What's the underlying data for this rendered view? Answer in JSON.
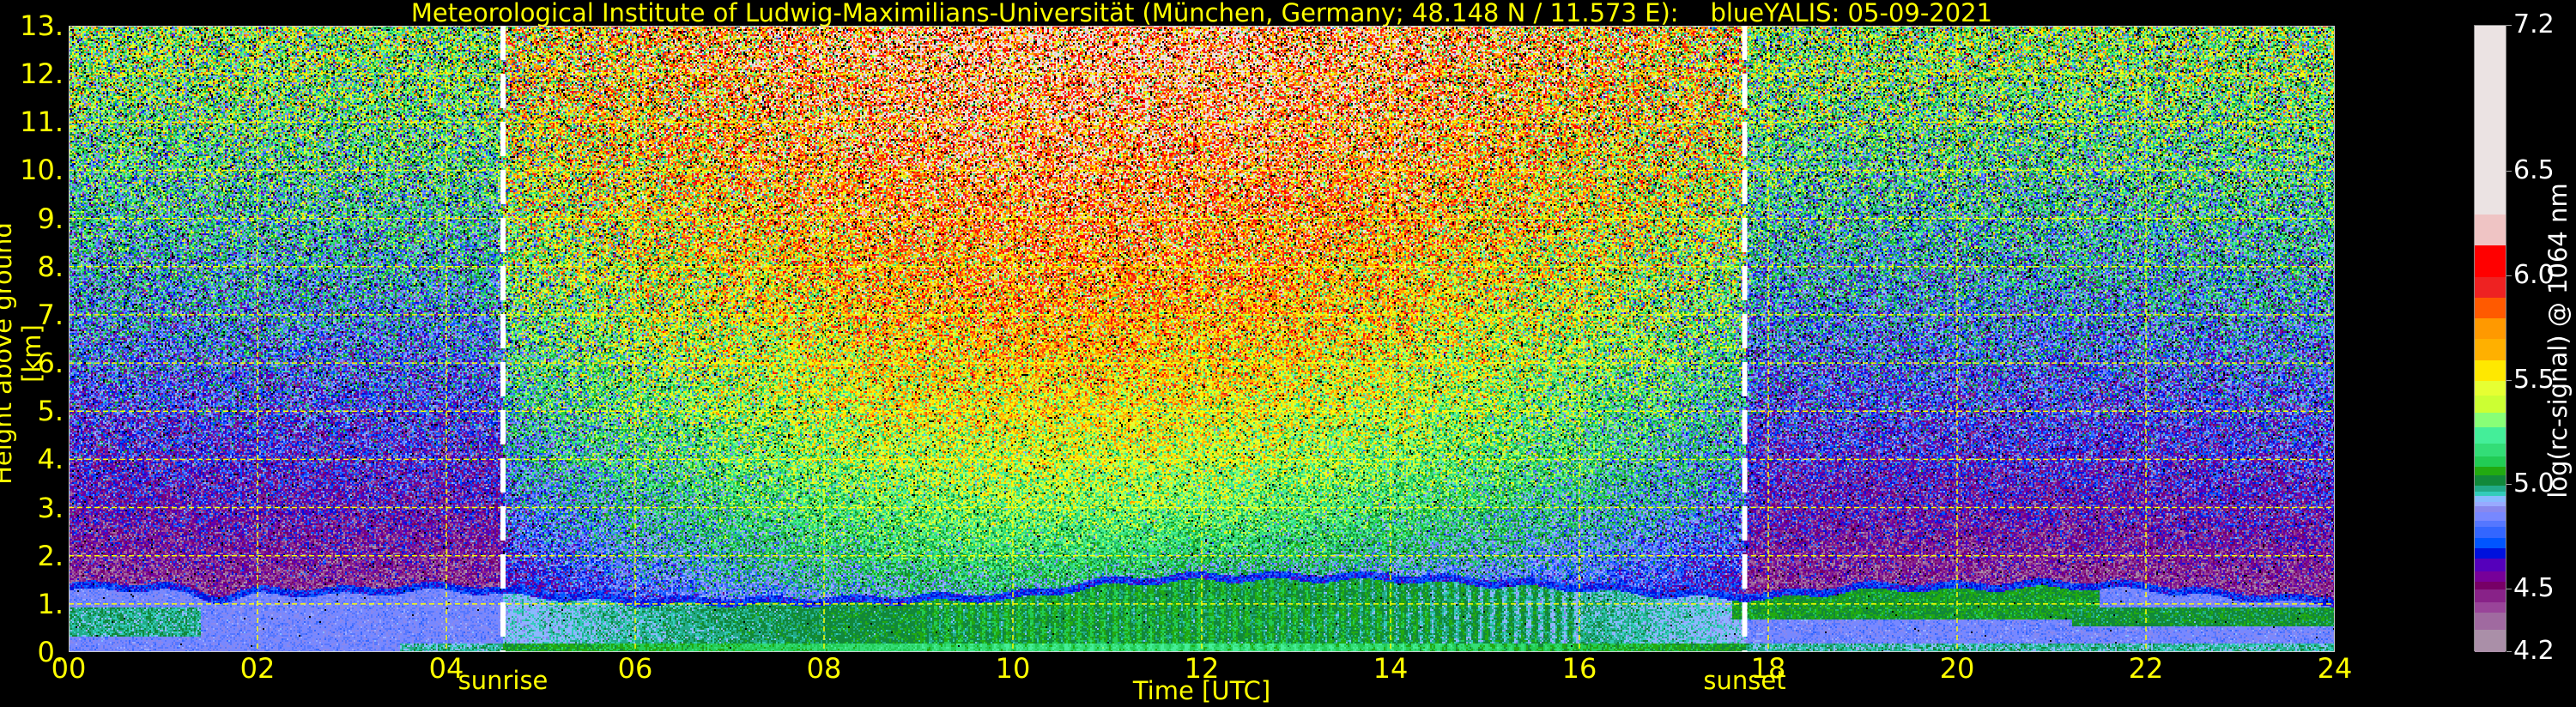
{
  "chart_data": {
    "type": "heatmap",
    "title": "Meteorological Institute of Ludwig-Maximilians-Universität (München, Germany; 48.148 N / 11.573 E):    blueYALIS: 05-09-2021",
    "xlabel": "Time [UTC]",
    "ylabel": "Height above ground [km]",
    "xlim": [
      0,
      24
    ],
    "ylim": [
      0,
      13
    ],
    "grid": true,
    "x_ticks": [
      0,
      2,
      4,
      6,
      8,
      10,
      12,
      14,
      16,
      18,
      20,
      22,
      24
    ],
    "x_tick_labels": [
      "00",
      "02",
      "04",
      "06",
      "08",
      "10",
      "12",
      "14",
      "16",
      "18",
      "20",
      "22",
      "24"
    ],
    "y_ticks": [
      0,
      1,
      2,
      3,
      4,
      5,
      6,
      7,
      8,
      9,
      10,
      11,
      12,
      13
    ],
    "y_tick_labels": [
      "0.",
      "1.",
      "2.",
      "3.",
      "4.",
      "5.",
      "6.",
      "7.",
      "8.",
      "9.",
      "10.",
      "11.",
      "12.",
      "13."
    ],
    "annotations": [
      {
        "label": "sunrise",
        "time": 4.6
      },
      {
        "label": "sunset",
        "time": 17.75
      }
    ],
    "colorbar": {
      "label": "log(rc-signal) @ 1064 nm",
      "range": [
        4.2,
        7.2
      ],
      "ticks": [
        4.2,
        4.5,
        5.0,
        5.5,
        6.0,
        6.5,
        7.2
      ],
      "tick_labels": [
        "4.2",
        "4.5",
        "5.0",
        "5.5",
        "6.0",
        "6.5",
        "7.2"
      ],
      "levels": [
        4.2,
        4.31,
        4.39,
        4.44,
        4.5,
        4.54,
        4.59,
        4.65,
        4.7,
        4.75,
        4.8,
        4.83,
        4.87,
        4.9,
        4.92,
        4.95,
        4.97,
        5.0,
        5.05,
        5.09,
        5.14,
        5.2,
        5.28,
        5.35,
        5.43,
        5.5,
        5.6,
        5.7,
        5.8,
        5.9,
        6.0,
        6.15,
        6.3,
        7.2
      ],
      "colors": [
        "#aa8fa8",
        "#a06aa0",
        "#994499",
        "#882288",
        "#770066",
        "#770099",
        "#5500bb",
        "#0011dd",
        "#0055ff",
        "#3366ff",
        "#5577ff",
        "#7788ff",
        "#8888ee",
        "#99aaff",
        "#88bbff",
        "#33ccbb",
        "#22aa88",
        "#11883a",
        "#22aa11",
        "#22cc55",
        "#33dd77",
        "#44ee99",
        "#88ff77",
        "#ccff33",
        "#e6ff33",
        "#ffe800",
        "#ffb000",
        "#ff9900",
        "#ff5a00",
        "#ee2222",
        "#ff0000",
        "#efc4c4",
        "#ebe3e3",
        "#ffffff"
      ]
    },
    "aerosol_layer_top_km": {
      "time": [
        0,
        1,
        1.6,
        2,
        3,
        4,
        4.6,
        6,
        8,
        10,
        11,
        12,
        13,
        14,
        16,
        17,
        18,
        19,
        20,
        21,
        22,
        23,
        24
      ],
      "height": [
        1.3,
        1.3,
        1.05,
        1.2,
        1.2,
        1.3,
        1.2,
        1.0,
        1.0,
        1.1,
        1.4,
        1.5,
        1.5,
        1.5,
        1.3,
        1.15,
        1.1,
        1.3,
        1.3,
        1.35,
        1.3,
        1.1,
        1.0
      ]
    },
    "approx_values": {
      "night_aloft_low": 4.45,
      "night_aloft_high": 5.25,
      "day_aloft_high": 6.1,
      "layer_night": 4.85,
      "layer_day": 5.05
    },
    "colors": {
      "text": "#ffff00",
      "grid": "#ffff00",
      "marker": "#ffffff",
      "background": "#000000"
    }
  }
}
